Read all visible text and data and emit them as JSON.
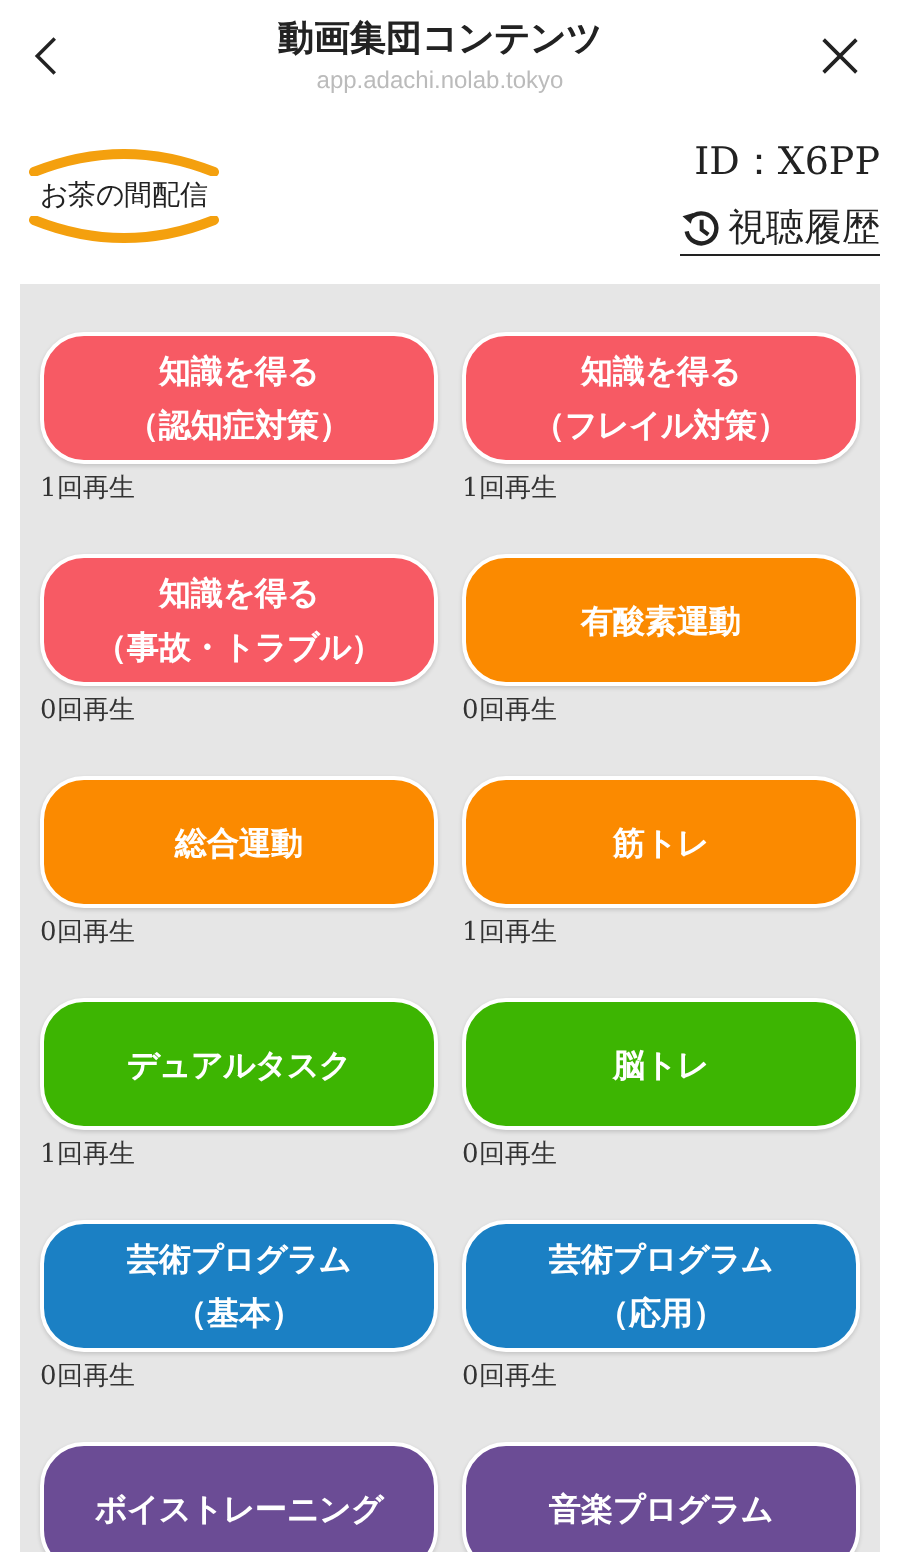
{
  "header": {
    "title": "動画集団コンテンツ",
    "url": "app.adachi.nolab.tokyo"
  },
  "logo": {
    "text": "お茶の間配信"
  },
  "user_id": "ID：X6PP",
  "history_link": "視聴履歴",
  "categories": [
    {
      "lines": [
        "知識を得る",
        "（認知症対策）"
      ],
      "color": "#f75a64",
      "plays": "1回再生"
    },
    {
      "lines": [
        "知識を得る",
        "（フレイル対策）"
      ],
      "color": "#f75a64",
      "plays": "1回再生"
    },
    {
      "lines": [
        "知識を得る",
        "（事故・トラブル）"
      ],
      "color": "#f75a64",
      "plays": "0回再生"
    },
    {
      "lines": [
        "有酸素運動"
      ],
      "color": "#fb8a00",
      "plays": "0回再生"
    },
    {
      "lines": [
        "総合運動"
      ],
      "color": "#fb8a00",
      "plays": "0回再生"
    },
    {
      "lines": [
        "筋トレ"
      ],
      "color": "#fb8a00",
      "plays": "1回再生"
    },
    {
      "lines": [
        "デュアルタスク"
      ],
      "color": "#3db502",
      "plays": "1回再生"
    },
    {
      "lines": [
        "脳トレ"
      ],
      "color": "#3db502",
      "plays": "0回再生"
    },
    {
      "lines": [
        "芸術プログラム",
        "（基本）"
      ],
      "color": "#1b80c4",
      "plays": "0回再生"
    },
    {
      "lines": [
        "芸術プログラム",
        "（応用）"
      ],
      "color": "#1b80c4",
      "plays": "0回再生"
    },
    {
      "lines": [
        "ボイストレーニング"
      ],
      "color": "#6b4c95"
    },
    {
      "lines": [
        "音楽プログラム"
      ],
      "color": "#6b4c95"
    }
  ]
}
